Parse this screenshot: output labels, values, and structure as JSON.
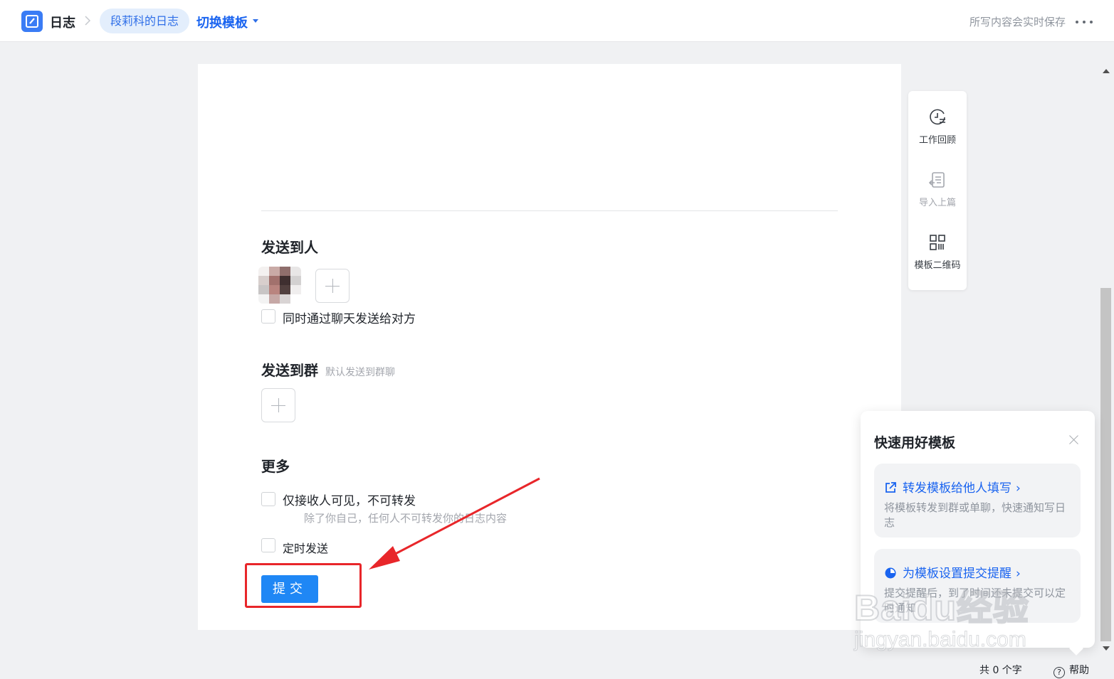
{
  "header": {
    "app_name": "日志",
    "breadcrumb_item": "段莉科的日志",
    "switch_template": "切换模板",
    "save_hint": "所写内容会实时保存"
  },
  "form": {
    "send_to_people": {
      "title": "发送到人",
      "also_chat_label": "同时通过聊天发送给对方"
    },
    "send_to_group": {
      "title": "发送到群",
      "hint": "默认发送到群聊"
    },
    "more": {
      "title": "更多",
      "receiver_only_label": "仅接收人可见，不可转发",
      "receiver_only_desc": "除了你自己，任何人不可转发你的日志内容",
      "scheduled_label": "定时发送"
    },
    "submit_label": "提交"
  },
  "tools": {
    "work_review": "工作回顾",
    "import_previous": "导入上篇",
    "template_qrcode": "模板二维码"
  },
  "popover": {
    "title": "快速用好模板",
    "tips": [
      {
        "title": "转发模板给他人填写",
        "desc": "将模板转发到群或单聊，快速通知写日志",
        "icon": "share-icon"
      },
      {
        "title": "为模板设置提交提醒",
        "desc": "提交提醒后，到了时间还未提交可以定时通知",
        "icon": "clock-pie-icon"
      }
    ]
  },
  "footer": {
    "word_count": "共 0 个字",
    "help": "帮助"
  },
  "watermark": {
    "logo": "Baidu经验",
    "url": "jingyan.baidu.com"
  },
  "colors": {
    "brand": "#1a64f0",
    "submit": "#1f87f5",
    "annotation": "#e8262a"
  }
}
